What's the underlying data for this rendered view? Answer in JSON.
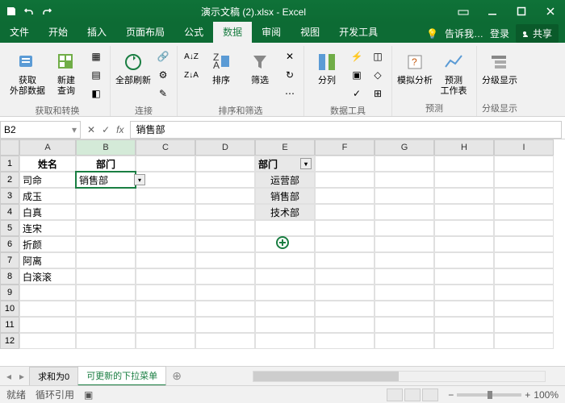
{
  "titlebar": {
    "title": "演示文稿 (2).xlsx - Excel"
  },
  "tabs": {
    "items": [
      "文件",
      "开始",
      "插入",
      "页面布局",
      "公式",
      "数据",
      "审阅",
      "视图",
      "开发工具"
    ],
    "active": "数据",
    "tellme": "告诉我…",
    "login": "登录",
    "share": "共享"
  },
  "ribbon": {
    "groups": [
      {
        "label": "获取和转换",
        "buttons": [
          "获取\n外部数据",
          "新建\n查询"
        ]
      },
      {
        "label": "连接",
        "buttons": [
          "全部刷新"
        ]
      },
      {
        "label": "排序和筛选",
        "buttons": [
          "排序",
          "筛选"
        ]
      },
      {
        "label": "数据工具",
        "buttons": [
          "分列"
        ]
      },
      {
        "label": "预测",
        "buttons": [
          "模拟分析",
          "预测\n工作表"
        ]
      },
      {
        "label": "分级显示",
        "buttons": [
          "分级显示"
        ]
      }
    ]
  },
  "namebox": {
    "ref": "B2",
    "formula": "销售部"
  },
  "columns": [
    "A",
    "B",
    "C",
    "D",
    "E",
    "F",
    "G",
    "H",
    "I"
  ],
  "rows": [
    1,
    2,
    3,
    4,
    5,
    6,
    7,
    8,
    9,
    10,
    11,
    12
  ],
  "cells": {
    "A1": "姓名",
    "B1": "部门",
    "E1": "部门",
    "A2": "司命",
    "B2": "销售部",
    "E2": "运营部",
    "A3": "成玉",
    "E3": "销售部",
    "A4": "白真",
    "E4": "技术部",
    "A5": "连宋",
    "A6": "折颜",
    "A7": "阿离",
    "A8": "白滚滚"
  },
  "sheettabs": {
    "items": [
      "求和为0",
      "可更新的下拉菜单"
    ],
    "active": "可更新的下拉菜单"
  },
  "statusbar": {
    "ready": "就绪",
    "circ": "循环引用",
    "zoom": "100%"
  }
}
